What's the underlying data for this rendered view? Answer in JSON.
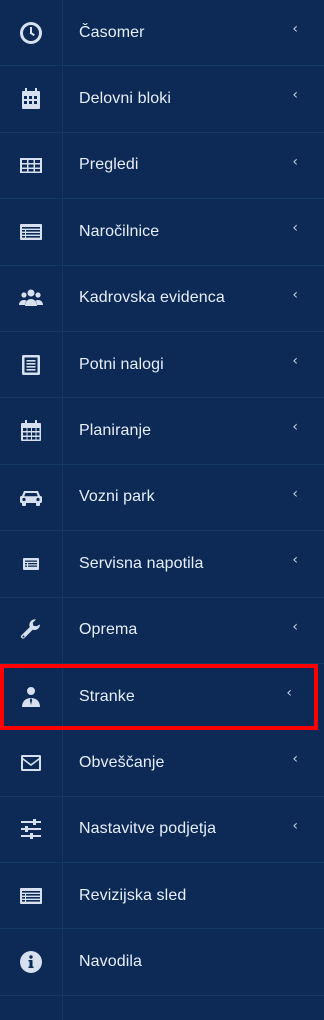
{
  "sidebar": {
    "items": [
      {
        "label": "Časomer",
        "icon": "clock-icon",
        "has_chevron": true
      },
      {
        "label": "Delovni bloki",
        "icon": "calendar-icon",
        "has_chevron": true
      },
      {
        "label": "Pregledi",
        "icon": "table-icon",
        "has_chevron": true
      },
      {
        "label": "Naročilnice",
        "icon": "list-icon",
        "has_chevron": true
      },
      {
        "label": "Kadrovska evidenca",
        "icon": "users-icon",
        "has_chevron": true
      },
      {
        "label": "Potni nalogi",
        "icon": "document-icon",
        "has_chevron": true
      },
      {
        "label": "Planiranje",
        "icon": "calendar-grid-icon",
        "has_chevron": true
      },
      {
        "label": "Vozni park",
        "icon": "car-icon",
        "has_chevron": true
      },
      {
        "label": "Servisna napotila",
        "icon": "list-small-icon",
        "has_chevron": true
      },
      {
        "label": "Oprema",
        "icon": "wrench-icon",
        "has_chevron": true
      },
      {
        "label": "Stranke",
        "icon": "user-tie-icon",
        "has_chevron": true,
        "highlighted": true
      },
      {
        "label": "Obveščanje",
        "icon": "envelope-icon",
        "has_chevron": true
      },
      {
        "label": "Nastavitve podjetja",
        "icon": "sliders-icon",
        "has_chevron": true
      },
      {
        "label": "Revizijska sled",
        "icon": "list-icon",
        "has_chevron": false
      },
      {
        "label": "Navodila",
        "icon": "info-icon",
        "has_chevron": false
      }
    ],
    "chevron_glyph": "‹",
    "colors": {
      "background": "#0c2a55",
      "divider": "#133865",
      "text": "#e6eef9",
      "icon": "#d6e0ee",
      "highlight": "#ff0000"
    }
  }
}
